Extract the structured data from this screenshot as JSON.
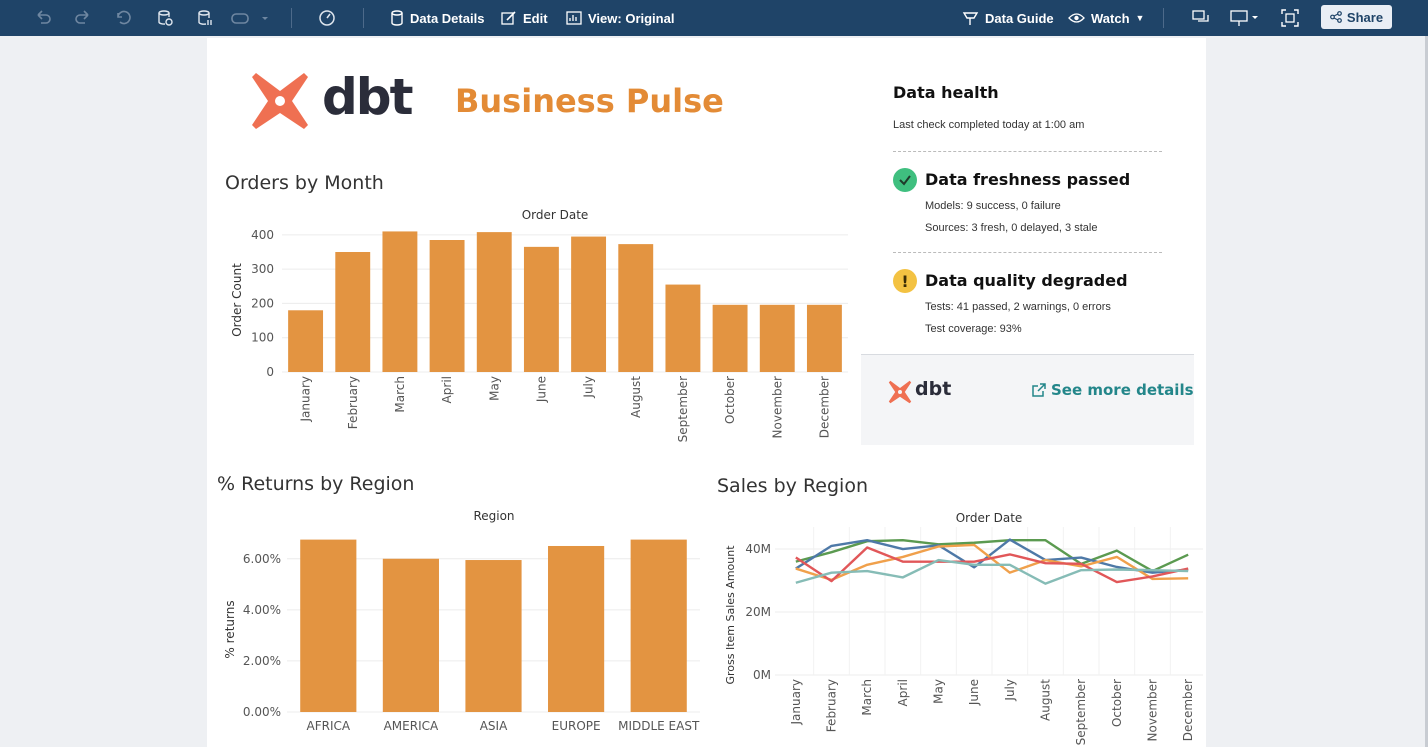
{
  "toolbar": {
    "data_details": "Data Details",
    "edit": "Edit",
    "view": "View: Original",
    "data_guide": "Data Guide",
    "watch": "Watch",
    "share": "Share"
  },
  "header": {
    "logo_text": "dbt",
    "title": "Business Pulse"
  },
  "orders_chart": {
    "section_title": "Orders by Month",
    "chart_data": {
      "type": "bar",
      "title": "Order Date",
      "ylabel": "Order Count",
      "categories": [
        "January",
        "February",
        "March",
        "April",
        "May",
        "June",
        "July",
        "August",
        "September",
        "October",
        "November",
        "December"
      ],
      "values": [
        180,
        350,
        410,
        385,
        408,
        365,
        395,
        373,
        255,
        196,
        196,
        196
      ],
      "yticks": [
        0,
        100,
        200,
        300,
        400
      ],
      "ylim": [
        0,
        420
      ],
      "color": "#e39441"
    }
  },
  "returns_chart": {
    "section_title": "% Returns by Region",
    "chart_data": {
      "type": "bar",
      "title": "Region",
      "ylabel": "% returns",
      "categories": [
        "AFRICA",
        "AMERICA",
        "ASIA",
        "EUROPE",
        "MIDDLE EAST"
      ],
      "values": [
        6.75,
        6.0,
        5.95,
        6.5,
        6.75
      ],
      "yticks": [
        "0.00%",
        "2.00%",
        "4.00%",
        "6.00%"
      ],
      "ytick_values": [
        0,
        2,
        4,
        6
      ],
      "ylim": [
        0,
        7.4
      ],
      "color": "#e39441"
    }
  },
  "sales_chart": {
    "section_title": "Sales by Region",
    "chart_data": {
      "type": "line",
      "title": "Order Date",
      "ylabel": "Gross Item Sales Amount",
      "categories": [
        "January",
        "February",
        "March",
        "April",
        "May",
        "June",
        "July",
        "August",
        "September",
        "October",
        "November",
        "December"
      ],
      "yticks": [
        "0M",
        "20M",
        "40M"
      ],
      "ytick_values": [
        0,
        20,
        40
      ],
      "ylim": [
        0,
        47
      ],
      "series": [
        {
          "color": "#5b9a50",
          "values": [
            36,
            39,
            42.5,
            42.8,
            41.5,
            42,
            42.8,
            42.8,
            35.3,
            39.5,
            33,
            38.2
          ]
        },
        {
          "color": "#4e79a7",
          "values": [
            33.8,
            41,
            42.8,
            40,
            41.2,
            34.2,
            43,
            36.5,
            37.3,
            34.3,
            32.5,
            33.5
          ]
        },
        {
          "color": "#f0a04b",
          "values": [
            33.8,
            30.2,
            35,
            37.5,
            40.8,
            41.3,
            32.5,
            36.5,
            34.5,
            37.5,
            30.5,
            30.7
          ]
        },
        {
          "color": "#e15759",
          "values": [
            37.3,
            29.8,
            40.5,
            36,
            36,
            36,
            38.3,
            35.5,
            35.3,
            29.5,
            31.3,
            33.8
          ]
        },
        {
          "color": "#86bcb6",
          "values": [
            29.3,
            32.5,
            33,
            31,
            36.5,
            35,
            35,
            29,
            33.3,
            33.5,
            33.3,
            33
          ]
        }
      ]
    }
  },
  "data_health": {
    "title": "Data health",
    "subtitle": "Last check completed today at 1:00 am",
    "freshness": {
      "status": "passed",
      "heading": "Data freshness passed",
      "line1": "Models: 9 success, 0 failure",
      "line2": "Sources: 3 fresh, 0 delayed, 3 stale"
    },
    "quality": {
      "status": "degraded",
      "heading": "Data quality degraded",
      "line1": "Tests: 41 passed, 2 warnings, 0 errors",
      "line2": "Test coverage: 93%"
    },
    "footer_logo_text": "dbt",
    "see_more": "See more details"
  }
}
